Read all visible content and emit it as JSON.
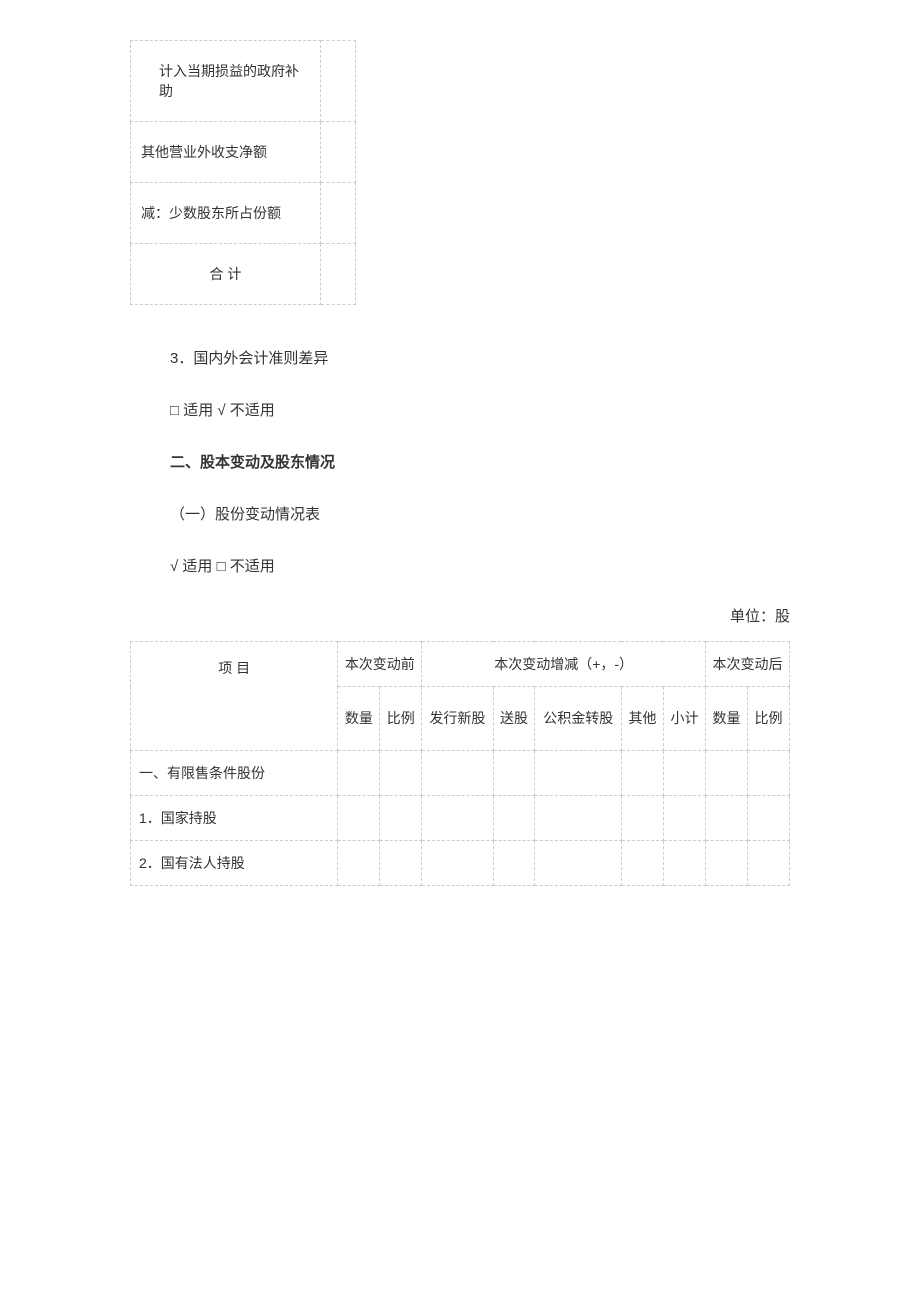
{
  "small_table": {
    "rows": [
      {
        "label": "计入当期损益的政府补助",
        "value": "",
        "indent": true
      },
      {
        "label": "其他营业外收支净额",
        "value": "",
        "indent": false
      },
      {
        "label": "减：少数股东所占份额",
        "value": "",
        "indent": false
      },
      {
        "label": "合 计",
        "value": "",
        "centered": true
      }
    ]
  },
  "sections": {
    "s1": "3．国内外会计准则差异",
    "s2": "□ 适用 √ 不适用",
    "s3": "二、股本变动及股东情况",
    "s4": "（一）股份变动情况表",
    "s5": "√ 适用 □ 不适用"
  },
  "unit": "单位：股",
  "main_table": {
    "head": {
      "item": "项 目",
      "before": "本次变动前",
      "change": "本次变动增减（+，-）",
      "after": "本次变动后",
      "qty": "数量",
      "ratio": "比例",
      "new_issue": "发行新股",
      "bonus": "送股",
      "fund": "公积金转股",
      "other": "其他",
      "subtotal": "小计"
    },
    "rows": [
      {
        "label": "一、有限售条件股份"
      },
      {
        "label": "1．国家持股"
      },
      {
        "label": "2．国有法人持股"
      }
    ]
  }
}
